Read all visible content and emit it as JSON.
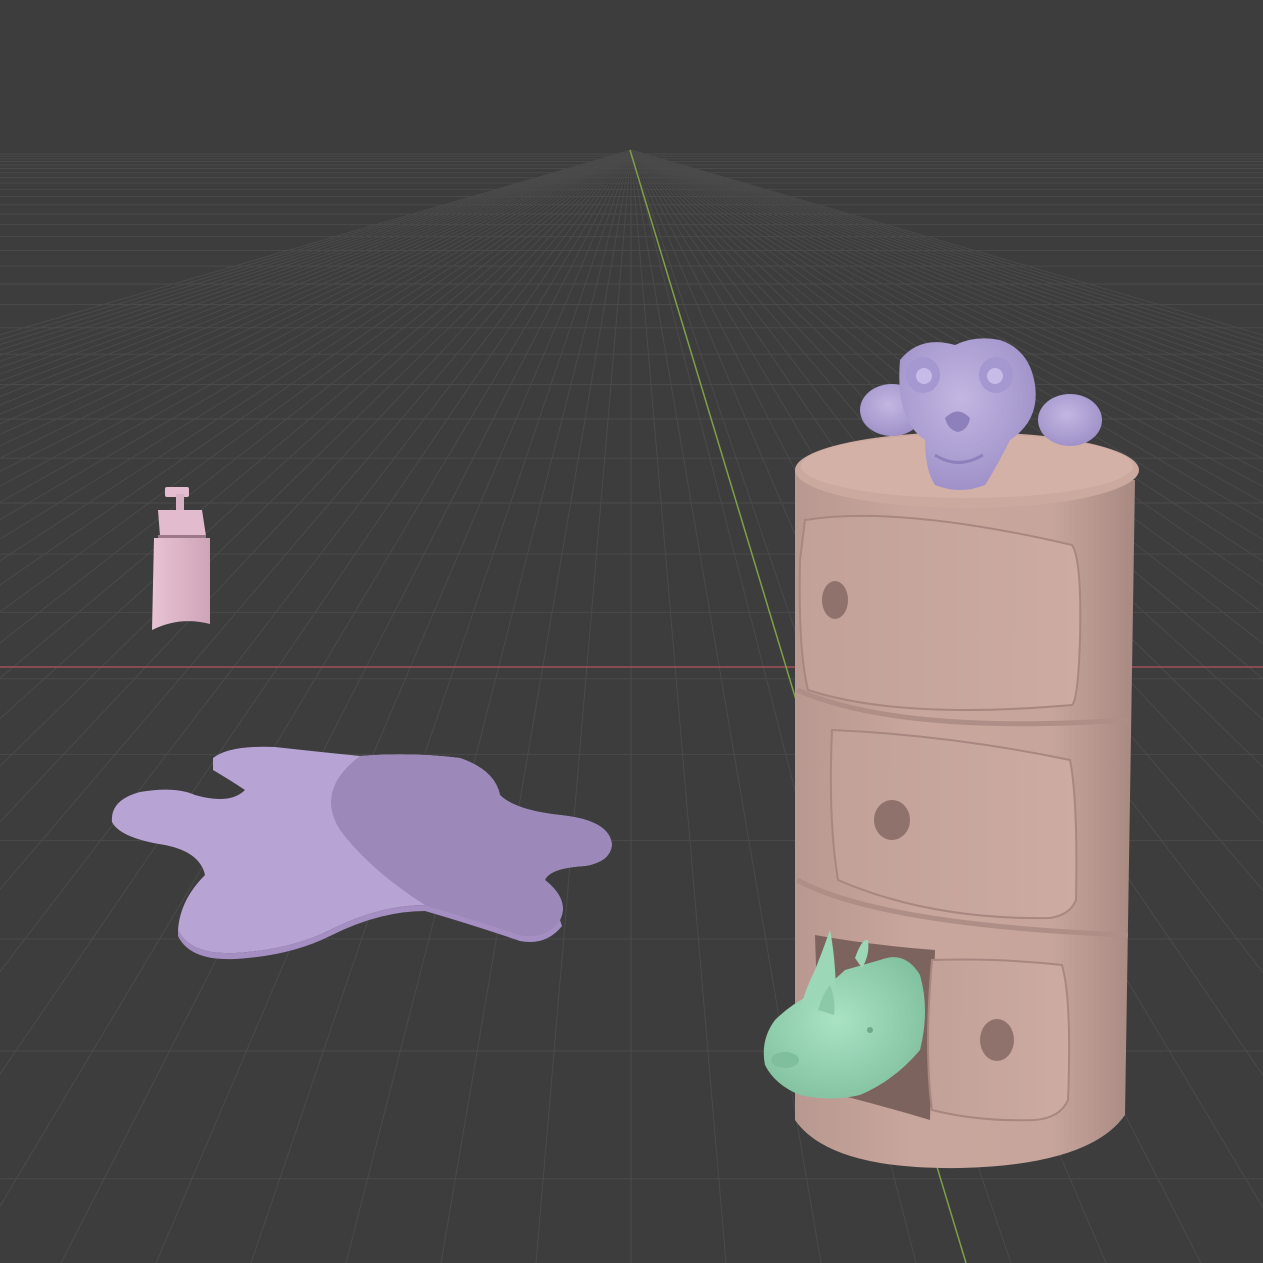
{
  "viewport": {
    "background_color": "#3d3d3d",
    "grid_color": "#4a4a4a",
    "x_axis_color": "#a0505a",
    "y_axis_color": "#7ea046"
  },
  "objects": {
    "cabinet": {
      "color": "#c9a69d",
      "shadow_color": "#ad8d85",
      "hole_color": "#8f726b",
      "icon": "round-drawer-cabinet-icon"
    },
    "monkey": {
      "color": "#b2a4d6",
      "icon": "monkey-head-icon"
    },
    "rhino": {
      "color": "#9ad6b6",
      "icon": "rhino-head-icon"
    },
    "bottle": {
      "color": "#e1b9cc",
      "icon": "pump-bottle-icon"
    },
    "rug": {
      "color": "#b6a2d3",
      "shade_color": "#9d89ba",
      "icon": "bear-rug-icon"
    }
  }
}
